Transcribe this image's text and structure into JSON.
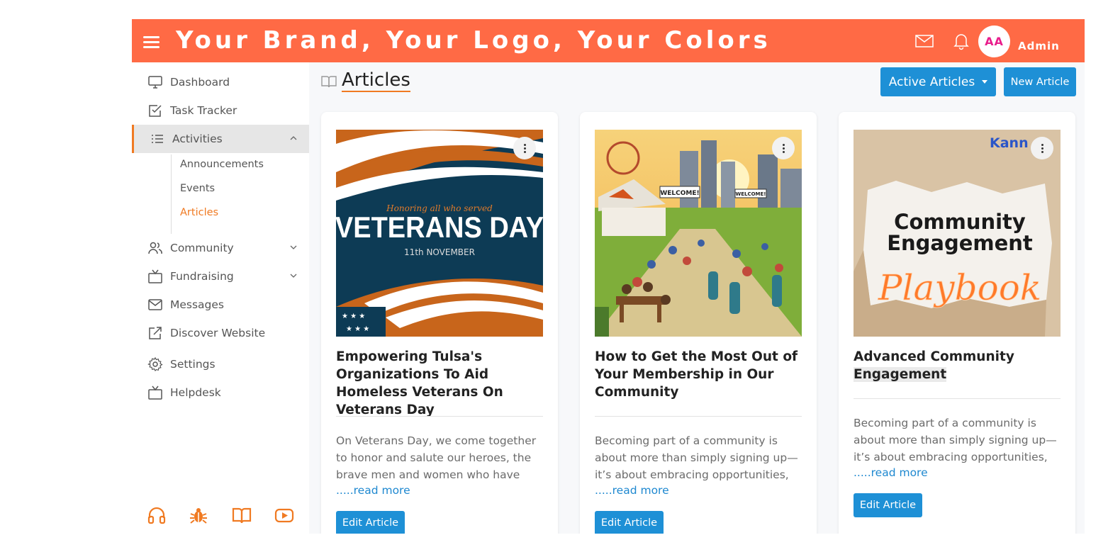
{
  "header": {
    "brand": "Your Brand, Your Logo, Your Colors",
    "avatar_initials": "AA",
    "user_label": "Admin",
    "color": "#ff6a45"
  },
  "sidebar": {
    "items": [
      {
        "label": "Dashboard",
        "icon": "monitor-icon"
      },
      {
        "label": "Task Tracker",
        "icon": "checkbox-icon"
      },
      {
        "label": "Activities",
        "icon": "list-icon"
      },
      {
        "label": "Community",
        "icon": "users-icon"
      },
      {
        "label": "Fundraising",
        "icon": "tv-icon"
      },
      {
        "label": "Messages",
        "icon": "mail-icon"
      },
      {
        "label": "Discover Website",
        "icon": "external-link-icon"
      },
      {
        "label": "Settings",
        "icon": "gear-icon"
      },
      {
        "label": "Helpdesk",
        "icon": "tv-icon"
      }
    ],
    "sub_items": [
      "Announcements",
      "Events",
      "Articles"
    ],
    "active_sub": "Articles",
    "accent": "#f07a22"
  },
  "main": {
    "title": "Articles",
    "filter_button": "Active Articles",
    "new_button": "New Article",
    "cards": [
      {
        "image_title": "VETERANS DAY",
        "image_script": "Honoring all who served",
        "image_date": "11th NOVEMBER",
        "title": "Empowering Tulsa's Organizations To Aid Homeless Veterans On Veterans Day",
        "description": "On Veterans Day, we come together to honor and salute our heroes, the brave men and women who have",
        "read_more": ".....read more",
        "edit_label": "Edit Article"
      },
      {
        "image_sign_1": "WELCOME!",
        "image_sign_2": "WELCOME!",
        "title": "How to Get the Most Out of Your Membership in Our Community",
        "description": "Becoming part of a community is about more than simply signing up—it’s about embracing opportunities,",
        "read_more": ".....read more",
        "edit_label": "Edit Article"
      },
      {
        "image_brand": "Kann",
        "image_line_1": "Community",
        "image_line_2": "Engagement",
        "image_script": "Playbook",
        "title_part_1": "Advanced Community",
        "title_part_2": "Engagement",
        "description": "Becoming part of a community is about more than simply signing up—it’s about embracing opportunities,",
        "read_more": ".....read more",
        "edit_label": "Edit Article"
      }
    ]
  }
}
